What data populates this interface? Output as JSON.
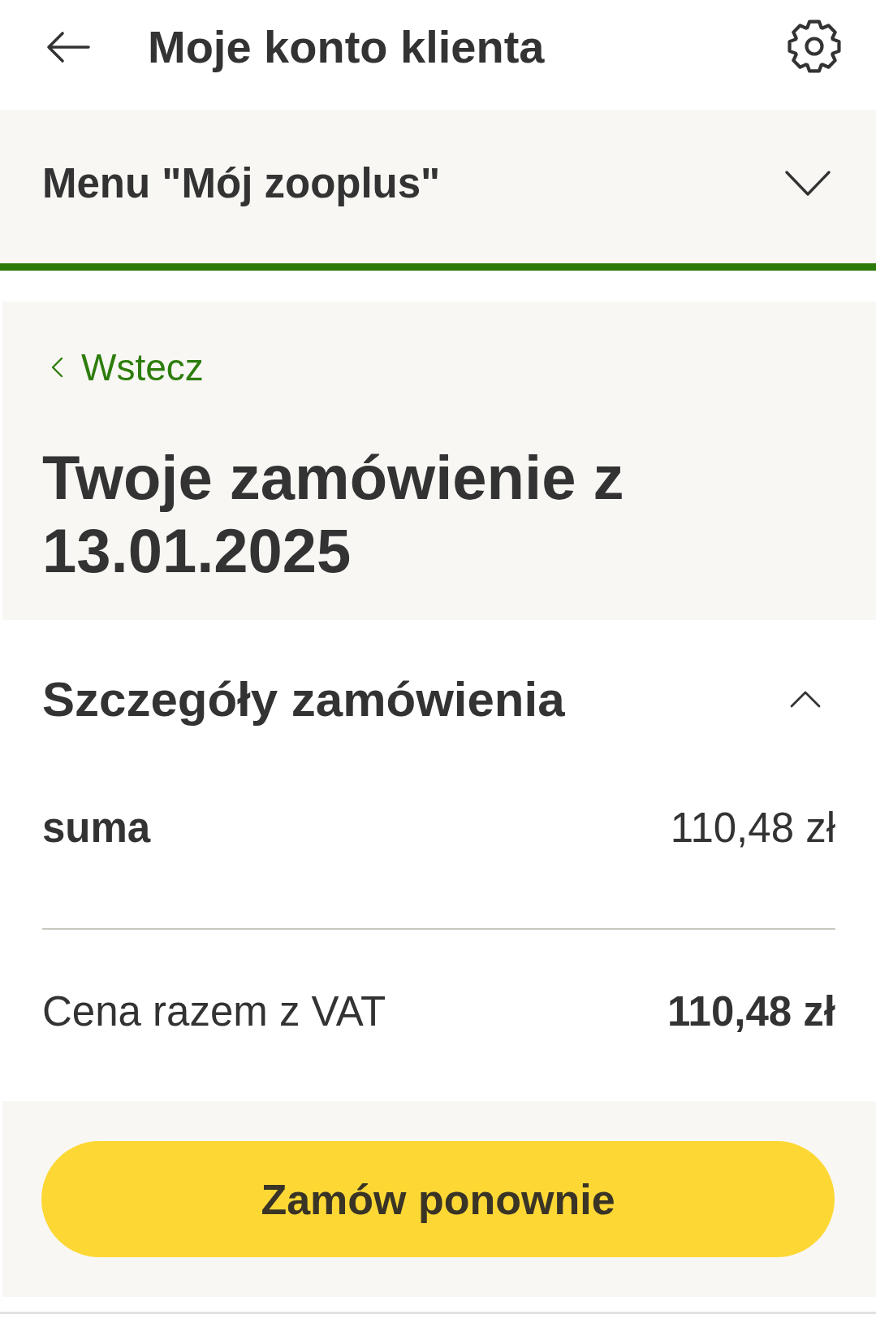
{
  "header": {
    "title": "Moje konto klienta"
  },
  "menu": {
    "label": "Menu \"Mój zooplus\"",
    "expanded": false
  },
  "order": {
    "back_link": "Wstecz",
    "title": "Twoje zamówienie z 13.01.2025"
  },
  "details": {
    "title": "Szczegóły zamówienia",
    "expanded": true,
    "rows": [
      {
        "kind": "subtotal",
        "label": "suma",
        "value": "110,48 zł"
      },
      {
        "kind": "total",
        "label": "Cena razem z VAT",
        "value": "110,48 zł"
      }
    ]
  },
  "action": {
    "label": "Zamów ponownie"
  }
}
